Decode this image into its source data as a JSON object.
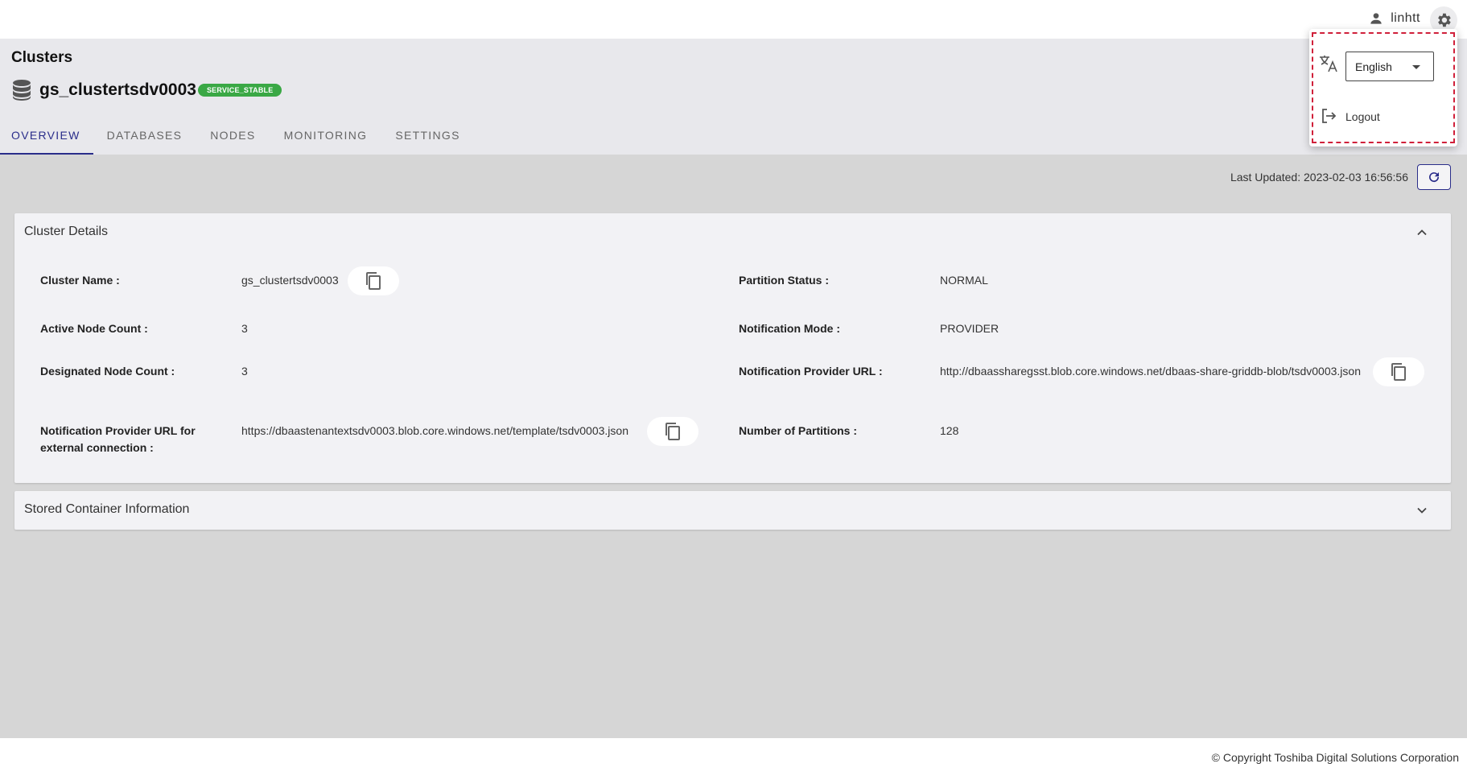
{
  "user": {
    "name": "linhtt"
  },
  "header": {
    "breadcrumb": "Clusters",
    "cluster_name": "gs_clustertsdv0003",
    "status_badge": "SERVICE_STABLE"
  },
  "tabs": [
    {
      "label": "OVERVIEW",
      "active": true
    },
    {
      "label": "DATABASES",
      "active": false
    },
    {
      "label": "NODES",
      "active": false
    },
    {
      "label": "MONITORING",
      "active": false
    },
    {
      "label": "SETTINGS",
      "active": false
    }
  ],
  "last_updated": "Last Updated: 2023-02-03 16:56:56",
  "cluster_details": {
    "title": "Cluster Details",
    "fields": {
      "cluster_name": {
        "label": "Cluster Name :",
        "value": "gs_clustertsdv0003"
      },
      "active_node_count": {
        "label": "Active Node Count :",
        "value": "3"
      },
      "designated_node_count": {
        "label": "Designated Node Count :",
        "value": "3"
      },
      "external_url": {
        "label": "Notification Provider URL for external connection :",
        "value": "https://dbaastenantextsdv0003.blob.core.windows.net/template/tsdv0003.json"
      },
      "partition_status": {
        "label": "Partition Status :",
        "value": "NORMAL"
      },
      "notification_mode": {
        "label": "Notification Mode :",
        "value": "PROVIDER"
      },
      "provider_url": {
        "label": "Notification Provider URL :",
        "value": "http://dbaassharegsst.blob.core.windows.net/dbaas-share-griddb-blob/tsdv0003.json"
      },
      "number_of_partitions": {
        "label": "Number of Partitions :",
        "value": "128"
      }
    }
  },
  "stored_container": {
    "title": "Stored Container Information"
  },
  "settings_menu": {
    "language_value": "English",
    "logout_label": "Logout"
  },
  "footer": {
    "copyright": "© Copyright Toshiba Digital Solutions Corporation"
  },
  "colors": {
    "accent": "#2a2d8a",
    "badge": "#3aa845",
    "highlight_outline": "#d0203a"
  },
  "icons": [
    "user-icon",
    "gear-icon",
    "database-icon",
    "refresh-icon",
    "chevron-up-icon",
    "chevron-down-icon",
    "copy-icon",
    "translate-icon",
    "logout-icon"
  ]
}
